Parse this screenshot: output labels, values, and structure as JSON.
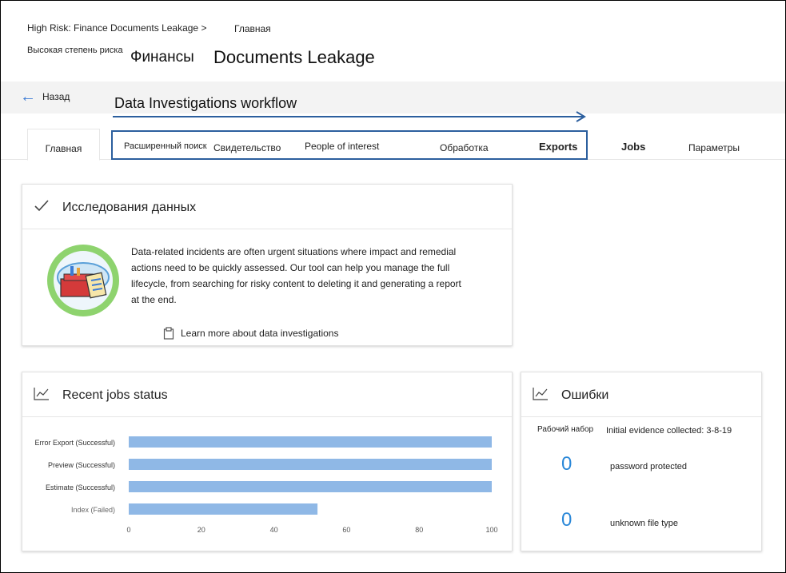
{
  "breadcrumb": {
    "path": "High Risk: Finance Documents Leakage >",
    "current": "Главная"
  },
  "title": {
    "prefix": "Высокая степень риска",
    "part1": "Финансы",
    "part2": "Documents Leakage"
  },
  "nav": {
    "back_label": "Назад"
  },
  "workflow": {
    "label": "Data Investigations workflow"
  },
  "tabs": {
    "home": "Главная",
    "search": "Расширенный поиск",
    "evidence": "Свидетельство",
    "people": "People of interest",
    "processing": "Обработка",
    "exports": "Exports",
    "jobs": "Jobs",
    "settings": "Параметры"
  },
  "data_investigations": {
    "title": "Исследования данных",
    "description": "Data-related incidents are often urgent situations where impact and remedial actions need to be quickly assessed. Our tool can help you manage the full lifecycle, from searching for risky content to deleting it and generating a report at the end.",
    "learn_more": "Learn more about data investigations"
  },
  "recent_jobs": {
    "title": "Recent jobs status"
  },
  "chart_data": {
    "type": "bar",
    "orientation": "horizontal",
    "categories": [
      "Error Export (Successful)",
      "Preview (Successful)",
      "Estimate (Successful)",
      "Index (Failed)"
    ],
    "values": [
      100,
      100,
      100,
      52
    ],
    "xticks": [
      0,
      20,
      40,
      60,
      80,
      100
    ],
    "xlim": [
      0,
      100
    ],
    "title": "",
    "xlabel": "",
    "ylabel": "",
    "color": "#8fb8e6"
  },
  "errors": {
    "title": "Ошибки",
    "workset_label": "Рабочий набор",
    "workset_value": "Initial evidence collected: 3-8-19",
    "items": [
      {
        "count": "0",
        "label": "password protected"
      },
      {
        "count": "0",
        "label": "unknown file type"
      }
    ]
  },
  "colors": {
    "accent": "#2b88d8",
    "workflow_border": "#2c5f9e",
    "bar": "#8fb8e6"
  }
}
